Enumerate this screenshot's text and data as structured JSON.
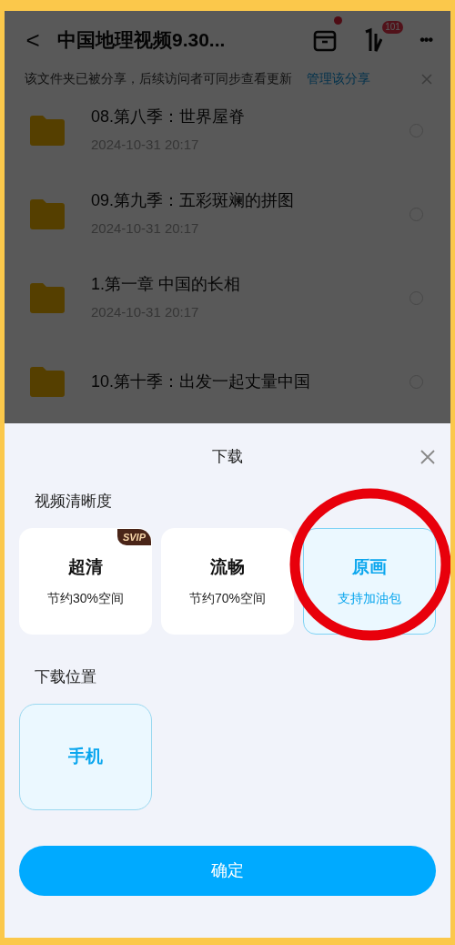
{
  "top_bar": {
    "back": "<",
    "title": "中国地理视频9.30...",
    "transfer_badge": "101",
    "more": "•••"
  },
  "share_banner": {
    "text": "该文件夹已被分享，后续访问者可同步查看更新",
    "link": "管理该分享"
  },
  "files": [
    {
      "name": "08.第八季：世界屋脊",
      "date": "2024-10-31  20:17"
    },
    {
      "name": "09.第九季：五彩斑斓的拼图",
      "date": "2024-10-31  20:17"
    },
    {
      "name": "1.第一章 中国的长相",
      "date": "2024-10-31  20:17"
    },
    {
      "name": "10.第十季：出发一起丈量中国"
    }
  ],
  "sheet": {
    "title": "下载",
    "quality_label": "视频清晰度",
    "quality_options": [
      {
        "name": "超清",
        "note": "节约30%空间",
        "badge": "SVIP",
        "selected": false
      },
      {
        "name": "流畅",
        "note": "节约70%空间",
        "selected": false
      },
      {
        "name": "原画",
        "note": "支持加油包",
        "selected": true
      }
    ],
    "location_label": "下载位置",
    "locations": [
      {
        "name": "手机",
        "selected": true
      }
    ],
    "confirm": "确定"
  }
}
